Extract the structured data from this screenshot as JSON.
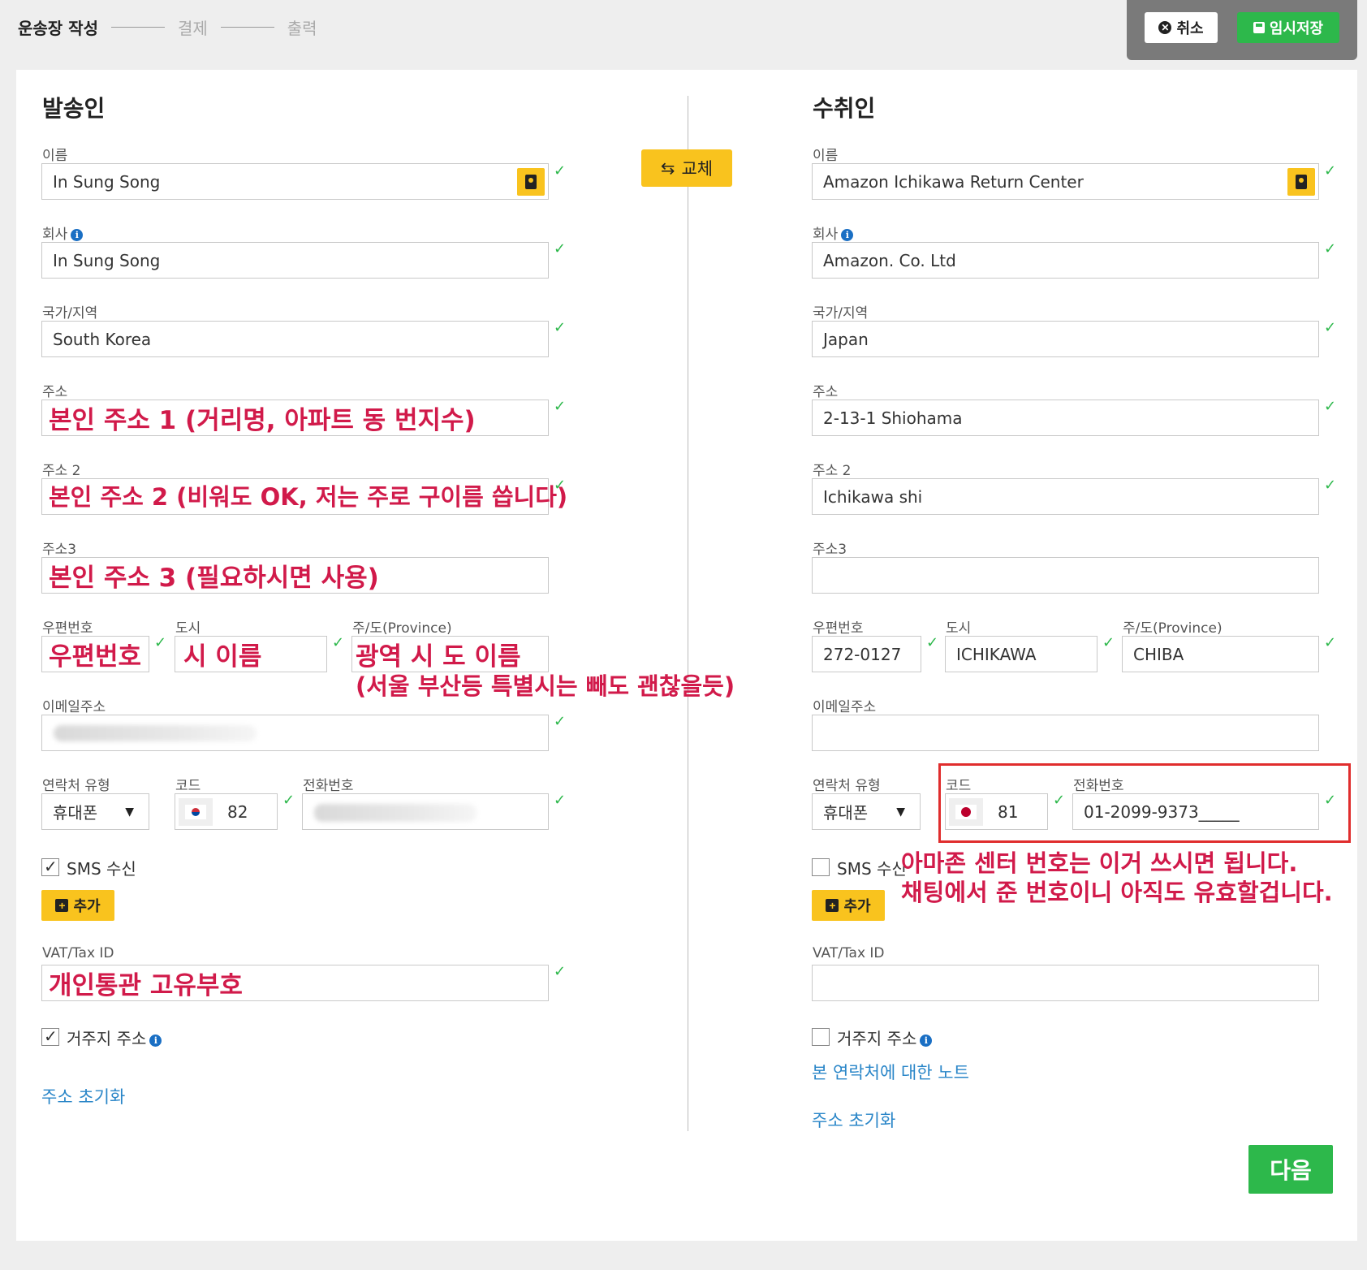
{
  "steps": [
    "운송장 작성",
    "결제",
    "출력"
  ],
  "actions": {
    "cancel": "취소",
    "save": "임시저장"
  },
  "swap_label": "교체",
  "sender": {
    "title": "발송인",
    "name_label": "이름",
    "name": "In Sung Song",
    "company_label": "회사",
    "company": "In Sung Song",
    "country_label": "국가/지역",
    "country": "South Korea",
    "address1_label": "주소",
    "address2_label": "주소 2",
    "address3_label": "주소3",
    "postal_label": "우편번호",
    "city_label": "도시",
    "province_label": "주/도(Province)",
    "email_label": "이메일주소",
    "contact_type_label": "연락처 유형",
    "contact_type": "휴대폰",
    "code_label": "코드",
    "code": "82",
    "phone_label": "전화번호",
    "sms_label": "SMS 수신",
    "sms_checked": true,
    "add_label": "추가",
    "vat_label": "VAT/Tax ID",
    "residential_label": "거주지 주소",
    "residential_checked": true,
    "reset_link": "주소 초기화"
  },
  "recipient": {
    "title": "수취인",
    "name_label": "이름",
    "name": "Amazon Ichikawa Return Center",
    "company_label": "회사",
    "company": "Amazon. Co. Ltd",
    "country_label": "국가/지역",
    "country": "Japan",
    "address1_label": "주소",
    "address1": "2-13-1 Shiohama",
    "address2_label": "주소 2",
    "address2": "Ichikawa shi",
    "address3_label": "주소3",
    "address3": "",
    "postal_label": "우편번호",
    "postal": "272-0127",
    "city_label": "도시",
    "city": "ICHIKAWA",
    "province_label": "주/도(Province)",
    "province": "CHIBA",
    "email_label": "이메일주소",
    "email": "",
    "contact_type_label": "연락처 유형",
    "contact_type": "휴대폰",
    "code_label": "코드",
    "code": "81",
    "phone_label": "전화번호",
    "phone": "01-2099-9373_____",
    "sms_label": "SMS 수신",
    "sms_checked": false,
    "add_label": "추가",
    "vat_label": "VAT/Tax ID",
    "vat": "",
    "residential_label": "거주지 주소",
    "residential_checked": false,
    "note_link": "본 연락처에 대한 노트",
    "reset_link": "주소 초기화"
  },
  "next_label": "다음",
  "annotations": {
    "addr1": "본인 주소 1 (거리명, 아파트 동 번지수)",
    "addr2": "본인 주소 2 (비워도 OK, 저는 주로 구이름 씁니다)",
    "addr3": "본인 주소 3 (필요하시면 사용)",
    "postal": "우편번호",
    "city": "시 이름",
    "province": "광역 시 도 이름",
    "province_note": "(서울 부산등 특별시는 빼도 괜찮을듯)",
    "vat": "개인통관 고유부호",
    "amazon_line1": "아마존 센터 번호는 이거 쓰시면 됩니다.",
    "amazon_line2": "채팅에서 준 번호이니 아직도 유효할겁니다."
  },
  "colors": {
    "accent_yellow": "#f9c31e",
    "success_green": "#2db84b",
    "annotation_red": "#d11a4a",
    "link_blue": "#2a86c8",
    "highlight_box": "#e02d2d"
  }
}
